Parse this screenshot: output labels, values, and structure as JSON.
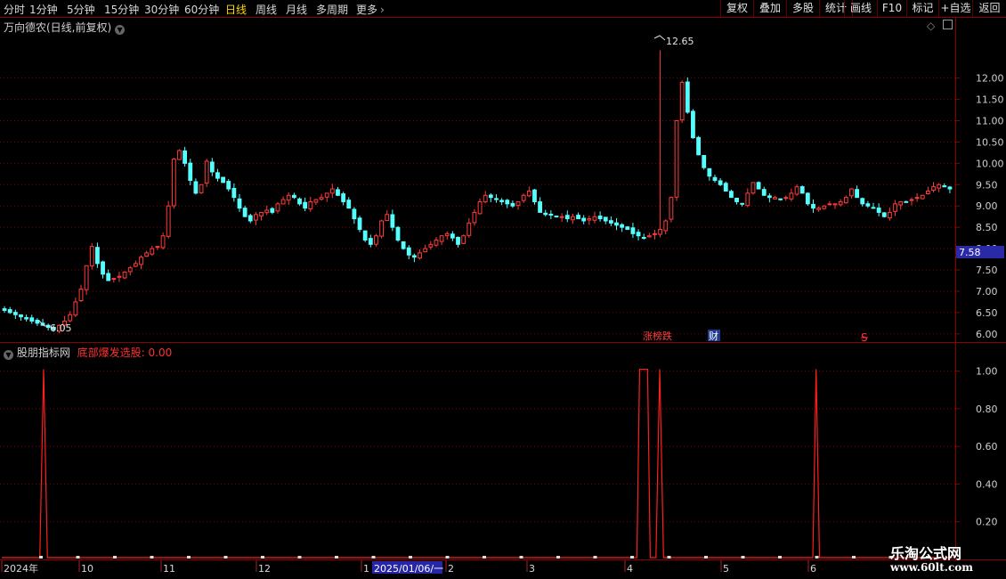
{
  "toolbar": {
    "periods": [
      "分时",
      "1分钟",
      "5分钟",
      "15分钟",
      "30分钟",
      "60分钟",
      "日线",
      "周线",
      "月线",
      "多周期",
      "更多"
    ],
    "active_index": 6,
    "right_buttons": [
      "复权",
      "叠加",
      "多股",
      "统计",
      "画线",
      "F10",
      "标记",
      "+自选",
      "返回"
    ]
  },
  "main": {
    "title": "万向德农(日线,前复权)",
    "price_ticks": [
      "12.00",
      "11.50",
      "11.00",
      "10.50",
      "10.00",
      "9.50",
      "9.00",
      "8.50",
      "8.00",
      "7.50",
      "7.00",
      "6.50",
      "6.00"
    ],
    "current_price": "7.58",
    "high_label": "12.65",
    "low_label": "6.05",
    "tags": {
      "longhu": "涨榜跌",
      "cai": "财",
      "s": "S"
    }
  },
  "indicator": {
    "name": "股朋指标网",
    "formula_label": "底部爆发选股:",
    "formula_value": "0.00",
    "ticks": [
      "1.00",
      "0.80",
      "0.60",
      "0.40",
      "0.20"
    ]
  },
  "date_axis": {
    "labels": [
      "2024年",
      "10",
      "11",
      "12",
      "1",
      "2025/01/06/一",
      "2",
      "3",
      "4",
      "5",
      "6"
    ]
  },
  "watermark": {
    "name": "乐淘公式网",
    "url": "www.60lt.com"
  },
  "colors": {
    "up": "#ff3b3b",
    "down": "#54ffff",
    "grid": "#8b0000",
    "signal": "#ff1e1e"
  },
  "chart_data": {
    "type": "candlestick",
    "title": "万向德农(日线,前复权)",
    "ylim": [
      5.85,
      13.1
    ],
    "price_path": [
      6.55,
      6.5,
      6.45,
      6.4,
      6.35,
      6.3,
      6.25,
      6.2,
      6.15,
      6.1,
      6.2,
      6.3,
      6.45,
      6.75,
      7.05,
      7.6,
      8.05,
      7.65,
      7.4,
      7.25,
      7.3,
      7.35,
      7.45,
      7.55,
      7.65,
      7.8,
      7.9,
      8.0,
      8.05,
      8.3,
      9.0,
      10.1,
      10.3,
      10.0,
      9.6,
      9.3,
      9.5,
      10.05,
      9.8,
      9.65,
      9.55,
      9.4,
      9.2,
      8.95,
      8.75,
      8.65,
      8.8,
      8.85,
      8.9,
      8.85,
      9.05,
      9.15,
      9.25,
      9.2,
      9.05,
      8.95,
      9.1,
      9.15,
      9.2,
      9.3,
      9.4,
      9.25,
      9.1,
      8.95,
      8.7,
      8.45,
      8.2,
      8.1,
      8.3,
      8.65,
      8.8,
      8.5,
      8.2,
      8.0,
      7.85,
      7.8,
      7.9,
      8.0,
      8.1,
      8.2,
      8.3,
      8.35,
      8.25,
      8.1,
      8.3,
      8.6,
      8.85,
      9.1,
      9.25,
      9.2,
      9.15,
      9.1,
      9.05,
      9.0,
      9.1,
      9.25,
      9.35,
      9.1,
      8.85,
      8.8,
      8.8,
      8.75,
      8.75,
      8.7,
      8.75,
      8.7,
      8.65,
      8.7,
      8.75,
      8.7,
      8.65,
      8.6,
      8.55,
      8.5,
      8.45,
      8.35,
      8.3,
      8.25,
      8.3,
      8.35,
      8.45,
      8.65,
      9.2,
      11.0,
      11.9,
      11.2,
      10.6,
      10.2,
      9.9,
      9.7,
      9.6,
      9.5,
      9.35,
      9.2,
      9.1,
      9.05,
      9.3,
      9.55,
      9.4,
      9.25,
      9.2,
      9.2,
      9.15,
      9.2,
      9.3,
      9.45,
      9.3,
      9.05,
      8.95,
      8.95,
      9.0,
      9.05,
      9.05,
      9.1,
      9.2,
      9.4,
      9.2,
      9.05,
      9.0,
      8.95,
      8.85,
      8.75,
      8.85,
      9.05,
      9.1,
      9.1,
      9.15,
      9.2,
      9.25,
      9.35,
      9.45,
      9.5,
      9.45,
      9.4
    ],
    "high": {
      "value": 12.65,
      "label": "12.65"
    },
    "low": {
      "value": 6.05,
      "label": "6.05"
    },
    "current_price": 7.58
  },
  "indicator_chart_data": {
    "type": "line",
    "name": "底部爆发选股",
    "ylim": [
      0,
      1.05
    ],
    "signals": [
      {
        "from": 0.04,
        "to": 0.048,
        "value": 1.0
      },
      {
        "from": 0.668,
        "to": 0.682,
        "value": 1.0
      },
      {
        "from": 0.688,
        "to": 0.696,
        "value": 1.0
      },
      {
        "from": 0.853,
        "to": 0.86,
        "value": 1.0
      }
    ]
  }
}
